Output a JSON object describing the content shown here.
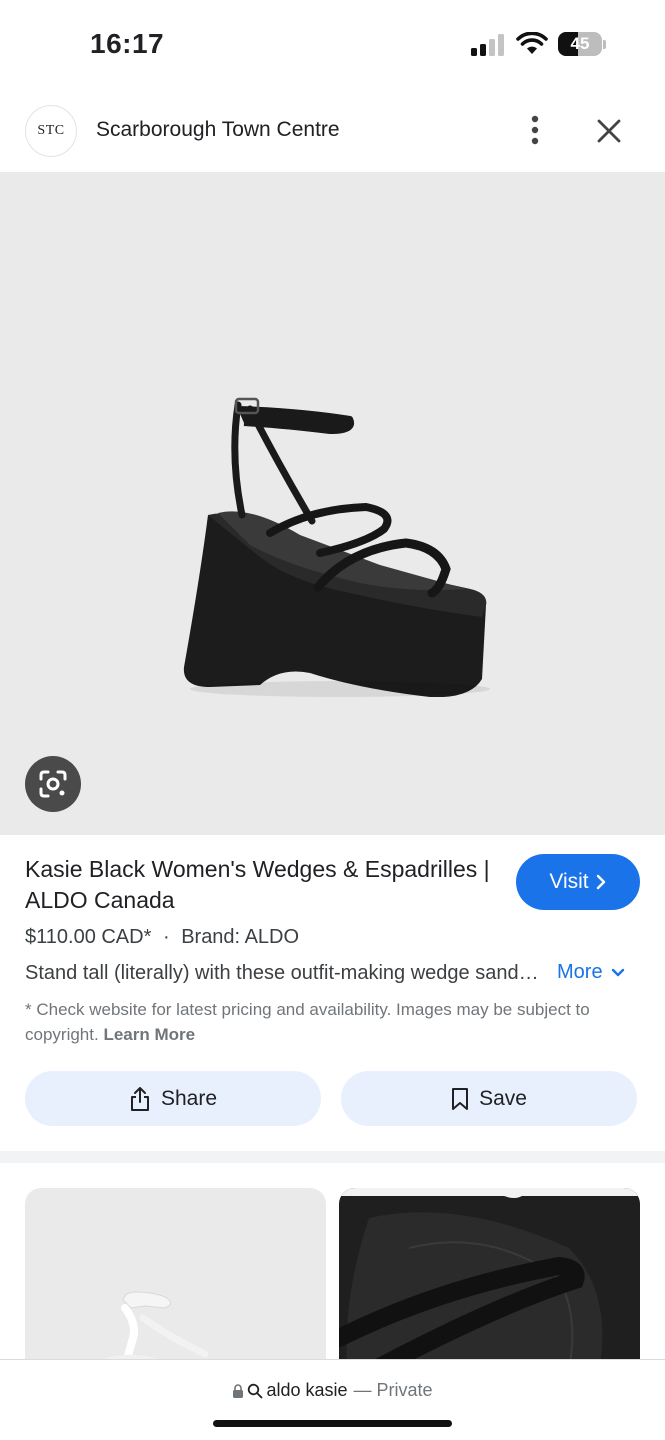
{
  "status_bar": {
    "time": "16:17",
    "battery_level": "45",
    "battery_fraction": 0.45,
    "icons": [
      "cellular-signal-icon",
      "wifi-icon",
      "battery-icon"
    ]
  },
  "header": {
    "logo_text": "STC",
    "site_name": "Scarborough Town Centre",
    "icons": [
      "more-vert-icon",
      "close-icon"
    ]
  },
  "image_viewer": {
    "lens_icon": "google-lens-icon"
  },
  "product": {
    "title": "Kasie Black Women's Wedges & Espadrilles | ALDO Canada",
    "price": "$110.00 CAD*",
    "separator": "·",
    "brand": "Brand: ALDO",
    "description": "Stand tall (literally) with these outfit-making wedge sandals.",
    "more_label": "More",
    "disclaimer": "* Check website for latest pricing and availability. Images may be subject to copyright.",
    "learn_more": "Learn More",
    "visit_label": "Visit"
  },
  "actions": {
    "share_label": "Share",
    "save_label": "Save"
  },
  "bottom_bar": {
    "query": "aldo kasie",
    "mode": "— Private"
  },
  "colors": {
    "accent": "#1a73e8",
    "button_bg": "#e8f0fe",
    "image_bg": "#ebeaeb"
  }
}
